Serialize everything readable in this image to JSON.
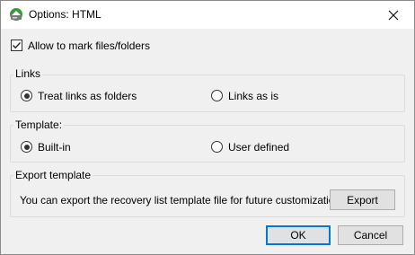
{
  "window": {
    "title": "Options: HTML",
    "icon": "app-drive-icon",
    "close_icon": "close-icon"
  },
  "allow_mark": {
    "label": "Allow to mark files/folders",
    "checked": true
  },
  "links": {
    "title": "Links",
    "options": [
      {
        "label": "Treat links as folders",
        "selected": true
      },
      {
        "label": "Links as is",
        "selected": false
      }
    ]
  },
  "template": {
    "title": "Template:",
    "options": [
      {
        "label": "Built-in",
        "selected": true
      },
      {
        "label": "User defined",
        "selected": false
      }
    ]
  },
  "export_template": {
    "title": "Export template",
    "description": "You can export the recovery list template file for future customization.",
    "button_label": "Export"
  },
  "buttons": {
    "ok_label": "OK",
    "cancel_label": "Cancel"
  },
  "colors": {
    "accent": "#0078d7",
    "background": "#f0f0f0",
    "titlebar": "#ffffff"
  }
}
